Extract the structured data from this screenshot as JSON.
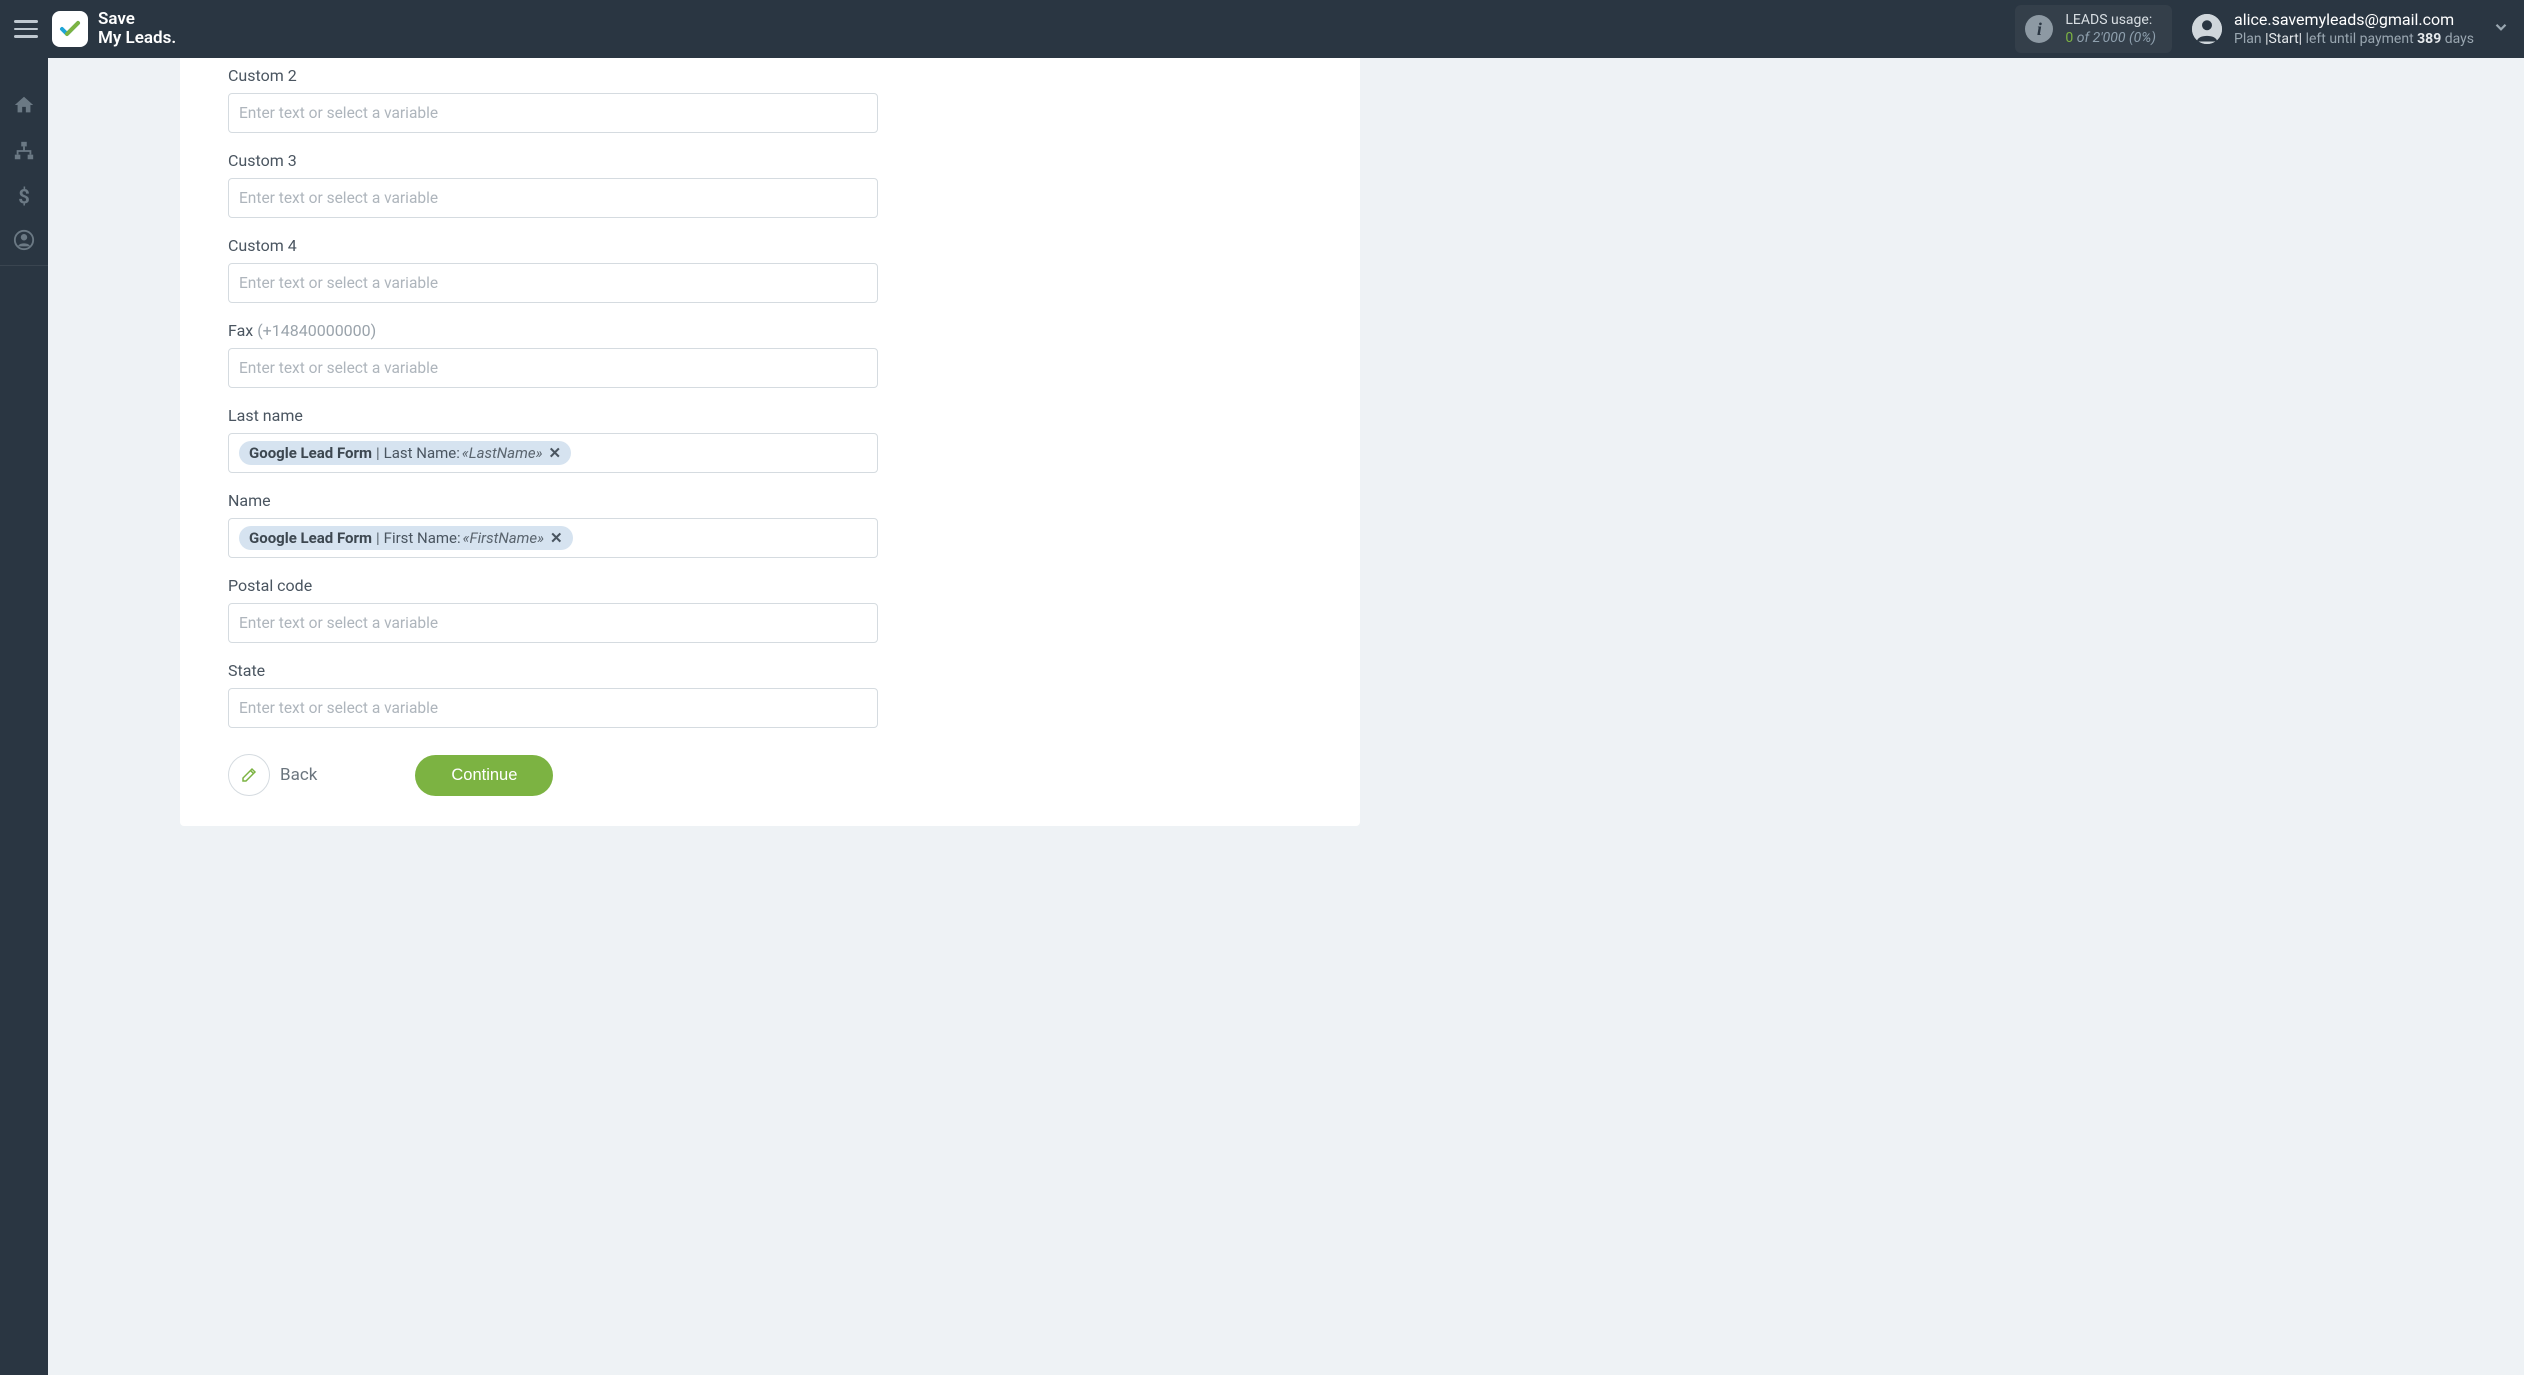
{
  "header": {
    "brand_line1": "Save",
    "brand_line2": "My Leads.",
    "usage_title": "LEADS usage:",
    "usage_current": "0",
    "usage_of": "of",
    "usage_total": "2'000",
    "usage_pct": "(0%)",
    "account_email": "alice.savemyleads@gmail.com",
    "plan_prefix": "Plan",
    "plan_name": "|Start|",
    "plan_suffix": "left until payment",
    "plan_days": "389",
    "plan_days_word": "days"
  },
  "fields": [
    {
      "label": "Custom 2",
      "hint": "",
      "placeholder": "Enter text or select a variable",
      "chip": null
    },
    {
      "label": "Custom 3",
      "hint": "",
      "placeholder": "Enter text or select a variable",
      "chip": null
    },
    {
      "label": "Custom 4",
      "hint": "",
      "placeholder": "Enter text or select a variable",
      "chip": null
    },
    {
      "label": "Fax",
      "hint": "(+14840000000)",
      "placeholder": "Enter text or select a variable",
      "chip": null
    },
    {
      "label": "Last name",
      "hint": "",
      "placeholder": "",
      "chip": {
        "source": "Google Lead Form",
        "field": "Last Name:",
        "var": "«LastName»"
      }
    },
    {
      "label": "Name",
      "hint": "",
      "placeholder": "",
      "chip": {
        "source": "Google Lead Form",
        "field": "First Name:",
        "var": "«FirstName»"
      }
    },
    {
      "label": "Postal code",
      "hint": "",
      "placeholder": "Enter text or select a variable",
      "chip": null
    },
    {
      "label": "State",
      "hint": "",
      "placeholder": "Enter text or select a variable",
      "chip": null
    }
  ],
  "actions": {
    "back": "Back",
    "continue": "Continue"
  }
}
